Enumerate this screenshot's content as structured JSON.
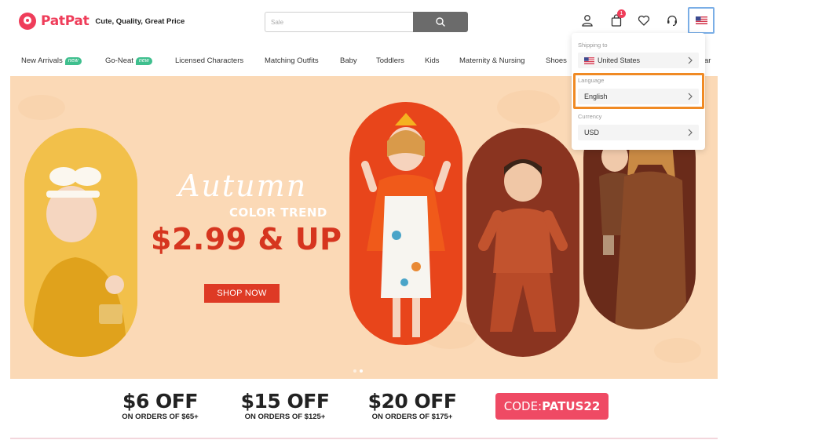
{
  "header": {
    "logo_text": "PatPat",
    "tagline": "Cute, Quality, Great Price",
    "search_placeholder": "Sale",
    "cart_count": "1",
    "icons": [
      "user-icon",
      "cart-icon",
      "heart-icon",
      "support-icon",
      "us-flag-icon"
    ]
  },
  "nav": {
    "items": [
      {
        "label": "New Arrivals",
        "tag": "new"
      },
      {
        "label": "Go-Neat",
        "tag": "new"
      },
      {
        "label": "Licensed Characters"
      },
      {
        "label": "Matching Outfits"
      },
      {
        "label": "Baby"
      },
      {
        "label": "Toddlers"
      },
      {
        "label": "Kids"
      },
      {
        "label": "Maternity & Nursing"
      },
      {
        "label": "Shoes"
      },
      {
        "label": "ar"
      }
    ]
  },
  "hero": {
    "script_text": "Autumn",
    "subtitle": "COLOR TREND",
    "price_text": "$2.99 & UP",
    "cta": "SHOP NOW",
    "slide_count": 2,
    "active_slide": 2
  },
  "offers": [
    {
      "amount": "$6 OFF",
      "condition": "ON ORDERS OF $65+"
    },
    {
      "amount": "$15 OFF",
      "condition": "ON ORDERS OF $125+"
    },
    {
      "amount": "$20 OFF",
      "condition": "ON ORDERS OF $175+"
    }
  ],
  "promo_code": {
    "prefix": "CODE:",
    "code": "PATUS22"
  },
  "settings_dropdown": {
    "shipping_label": "Shipping to",
    "shipping_value": "United States",
    "language_label": "Language",
    "language_value": "English",
    "currency_label": "Currency",
    "currency_value": "USD"
  },
  "colors": {
    "brand": "#ef3d5a",
    "hero_bg": "#fbd9b6",
    "cta": "#de3a25",
    "highlight_orange": "#f08a24",
    "highlight_blue": "#7aaee6",
    "new_tag": "#3fbf8e"
  }
}
